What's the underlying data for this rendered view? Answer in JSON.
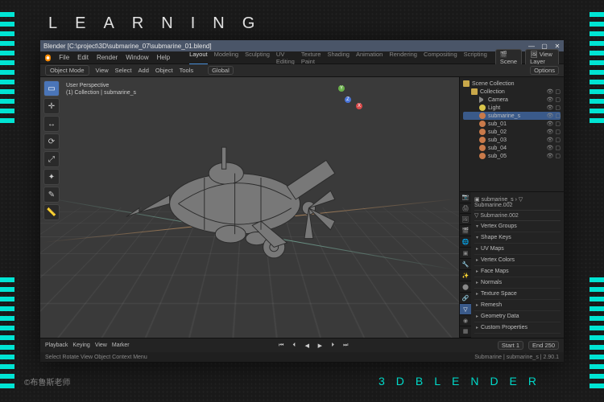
{
  "overlay": {
    "title": "LEARNING",
    "subtitle": "3DBLENDER",
    "credit": "©布鲁斯老师"
  },
  "titlebar": {
    "app": "Blender",
    "path": "[C:\\project\\3D\\submarine_07\\submarine_01.blend]"
  },
  "menubar": {
    "items": [
      "File",
      "Edit",
      "Render",
      "Window",
      "Help"
    ],
    "workspaces": [
      "Layout",
      "Modeling",
      "Sculpting",
      "UV Editing",
      "Texture Paint",
      "Shading",
      "Animation",
      "Rendering",
      "Compositing",
      "Scripting"
    ],
    "active_ws": "Layout",
    "scene_label": "Scene",
    "layer_label": "View Layer"
  },
  "toolstrip": {
    "left": [
      "Object Mode",
      "View",
      "Select",
      "Add",
      "Object",
      "Tools"
    ],
    "orientation": "Global",
    "options_label": "Options"
  },
  "viewport": {
    "persp": "User Perspective",
    "context": "(1) Collection | submarine_s",
    "tools": [
      "select",
      "cursor",
      "move",
      "rotate",
      "scale",
      "transform",
      "annotate",
      "measure"
    ]
  },
  "outliner": {
    "header": "Scene Collection",
    "items": [
      {
        "name": "Collection",
        "type": "coll",
        "indent": 1
      },
      {
        "name": "Camera",
        "type": "cam",
        "indent": 2
      },
      {
        "name": "Light",
        "type": "light",
        "indent": 2
      },
      {
        "name": "submarine_s",
        "type": "mesh",
        "indent": 2,
        "selected": true
      },
      {
        "name": "sub_01",
        "type": "mesh",
        "indent": 2
      },
      {
        "name": "sub_02",
        "type": "mesh",
        "indent": 2
      },
      {
        "name": "sub_03",
        "type": "mesh",
        "indent": 2
      },
      {
        "name": "sub_04",
        "type": "mesh",
        "indent": 2
      },
      {
        "name": "sub_05",
        "type": "mesh",
        "indent": 2
      }
    ]
  },
  "properties": {
    "crumb_a": "submarine_s",
    "crumb_b": "Submarine.002",
    "active_obj": "Submarine.002",
    "panels": [
      "Vertex Groups",
      "Shape Keys",
      "UV Maps",
      "Vertex Colors",
      "Face Maps",
      "Normals",
      "Texture Space",
      "Remesh",
      "Geometry Data",
      "Custom Properties"
    ]
  },
  "timeline": {
    "labels": [
      "Playback",
      "Keying",
      "View",
      "Marker"
    ],
    "start_label": "Start",
    "start": "1",
    "end_label": "End",
    "end": "250"
  },
  "statusbar": {
    "hints": "Select   Rotate View   Object Context Menu",
    "right": "Submarine | submarine_s | 2.90.1"
  }
}
